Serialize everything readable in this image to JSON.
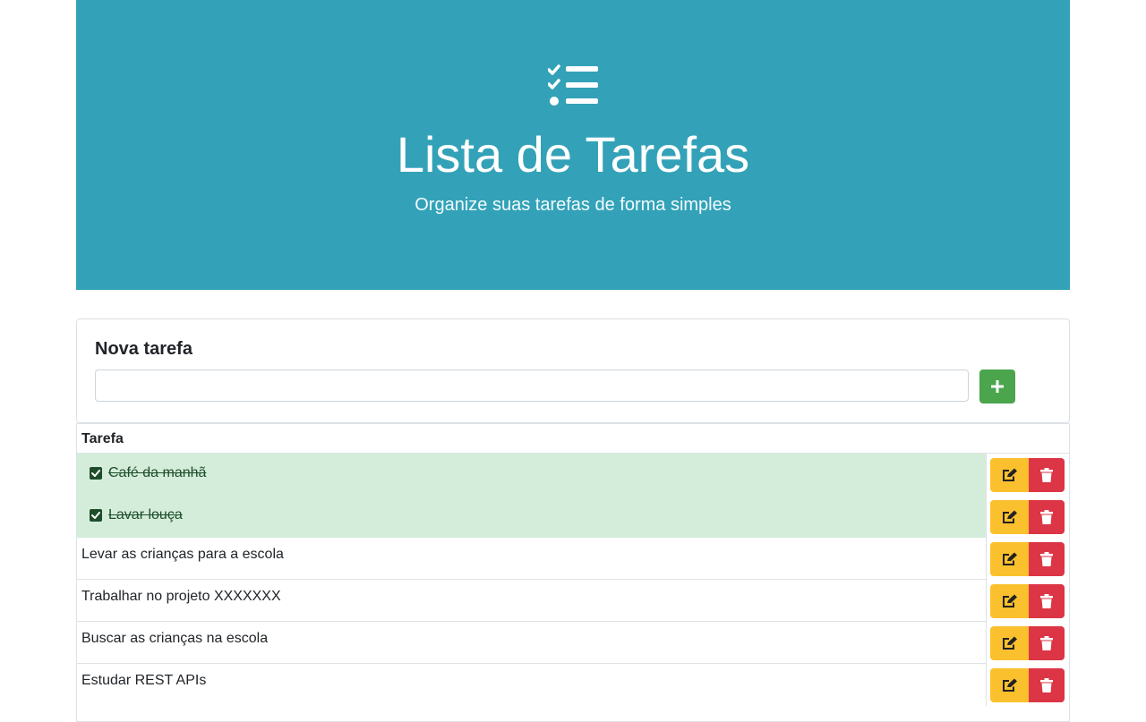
{
  "header": {
    "icon": "tasks-list-icon",
    "title": "Lista de Tarefas",
    "subtitle": "Organize suas tarefas de forma simples"
  },
  "form": {
    "label": "Nova tarefa",
    "input_value": "",
    "placeholder": "",
    "add_icon": "plus-icon"
  },
  "table": {
    "column_header": "Tarefa",
    "rows": [
      {
        "text": "Café da manhã",
        "done": true
      },
      {
        "text": "Lavar louça",
        "done": true
      },
      {
        "text": "Levar as crianças para a escola",
        "done": false
      },
      {
        "text": "Trabalhar no projeto XXXXXXX",
        "done": false
      },
      {
        "text": "Buscar as crianças na escola",
        "done": false
      },
      {
        "text": "Estudar REST APIs",
        "done": false
      }
    ],
    "edit_icon": "edit-icon",
    "delete_icon": "trash-icon"
  },
  "colors": {
    "header_bg": "#33a2b8",
    "add_button": "#4aa54c",
    "edit_button": "#fbc02d",
    "delete_button": "#dc3545",
    "done_row_bg": "#d4edda"
  }
}
